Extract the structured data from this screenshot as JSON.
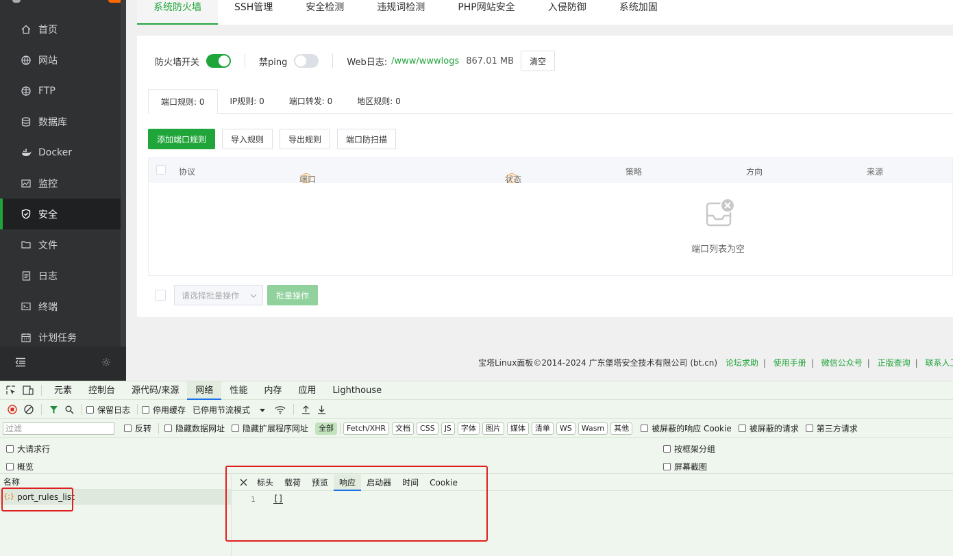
{
  "sidebar": {
    "items": [
      {
        "label": "首页",
        "icon": "home-icon"
      },
      {
        "label": "网站",
        "icon": "globe-icon"
      },
      {
        "label": "FTP",
        "icon": "ftp-globe-icon"
      },
      {
        "label": "数据库",
        "icon": "database-icon"
      },
      {
        "label": "Docker",
        "icon": "docker-icon"
      },
      {
        "label": "监控",
        "icon": "monitor-icon"
      },
      {
        "label": "安全",
        "icon": "shield-icon",
        "active": true
      },
      {
        "label": "文件",
        "icon": "folder-icon"
      },
      {
        "label": "日志",
        "icon": "log-icon"
      },
      {
        "label": "终端",
        "icon": "terminal-icon"
      },
      {
        "label": "计划任务",
        "icon": "calendar-icon"
      }
    ]
  },
  "top_tabs": [
    "系统防火墙",
    "SSH管理",
    "安全检测",
    "违规词检测",
    "PHP网站安全",
    "入侵防御",
    "系统加固"
  ],
  "firewall": {
    "switch_label": "防火墙开关",
    "switch_on": true,
    "ping_label": "禁ping",
    "ping_on": false,
    "weblog_label": "Web日志:",
    "weblog_path": "/www/wwwlogs",
    "weblog_size": "867.01 MB",
    "clear_label": "清空"
  },
  "rule_tabs": [
    "端口规则: 0",
    "IP规则: 0",
    "端口转发: 0",
    "地区规则: 0"
  ],
  "actions": {
    "add": "添加端口规则",
    "import": "导入规则",
    "export": "导出规则",
    "scan": "端口防扫描"
  },
  "table": {
    "columns": [
      "协议",
      "端口",
      "状态",
      "策略",
      "方向",
      "来源"
    ],
    "empty_text": "端口列表为空"
  },
  "batch": {
    "placeholder": "请选择批量操作",
    "button": "批量操作"
  },
  "footer": {
    "copyright": "宝塔Linux面板©2014-2024 广东堡塔安全技术有限公司 (bt.cn)",
    "links": [
      "论坛求助",
      "使用手册",
      "微信公众号",
      "正版查询",
      "联系人工客服"
    ]
  },
  "devtools": {
    "tabs": [
      "元素",
      "控制台",
      "源代码/来源",
      "网络",
      "性能",
      "内存",
      "应用",
      "Lighthouse"
    ],
    "active_tab": "网络",
    "preserve_log": "保留日志",
    "disable_cache": "停用缓存",
    "throttle": "已停用节流模式",
    "filter_placeholder": "过滤",
    "invert": "反转",
    "hide_data_urls": "隐藏数据网址",
    "hide_ext_urls": "隐藏扩展程序网址",
    "type_filters": [
      "全部",
      "Fetch/XHR",
      "文档",
      "CSS",
      "JS",
      "字体",
      "图片",
      "媒体",
      "清单",
      "WS",
      "Wasm",
      "其他"
    ],
    "blocked_cookies": "被屏蔽的响应 Cookie",
    "blocked_requests": "被屏蔽的请求",
    "third_party": "第三方请求",
    "big_rows": "大请求行",
    "overview": "概览",
    "group_by_frame": "按框架分组",
    "screenshots": "屏幕截图",
    "name_header": "名称",
    "request_name": "port_rules_list",
    "detail_tabs": [
      "标头",
      "载荷",
      "预览",
      "响应",
      "启动器",
      "时间",
      "Cookie"
    ],
    "active_detail": "响应",
    "response_line": "1",
    "response_body": "[]"
  }
}
